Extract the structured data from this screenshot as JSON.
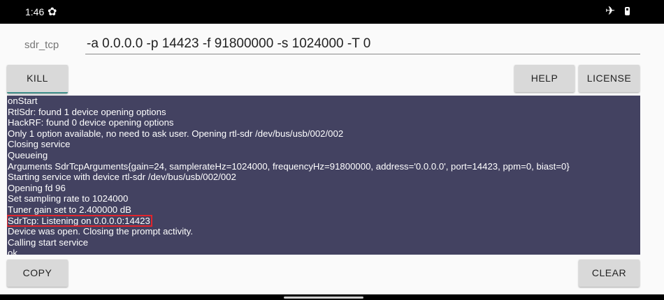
{
  "status_bar": {
    "time": "1:46",
    "icons": [
      "gear-icon",
      "airplane-mode-icon",
      "battery-icon"
    ]
  },
  "command": {
    "label": "sdr_tcp",
    "value": "-a 0.0.0.0 -p 14423 -f 91800000 -s 1024000 -T 0"
  },
  "buttons": {
    "kill": "KILL",
    "help": "HELP",
    "license": "LICENSE",
    "copy": "COPY",
    "clear": "CLEAR"
  },
  "log": {
    "lines": [
      "onStart",
      "RtlSdr: found 1 device opening options",
      "HackRF: found 0 device opening options",
      "Only 1 option available, no need to ask user. Opening rtl-sdr /dev/bus/usb/002/002",
      "Closing service",
      "Queueing",
      "Arguments SdrTcpArguments{gain=24, samplerateHz=1024000, frequencyHz=91800000, address='0.0.0.0', port=14423, ppm=0, biast=0}",
      "Starting service with device rtl-sdr /dev/bus/usb/002/002",
      "Opening fd 96",
      "Set sampling rate to 1024000",
      "Tuner gain set to 2.400000 dB",
      "SdrTcp: Listening on 0.0.0.0:14423",
      "Device was open. Closing the prompt activity.",
      "Calling start service",
      "ok"
    ],
    "highlighted_line": 11,
    "background": "#434261",
    "highlight_color": "#e1252c"
  }
}
